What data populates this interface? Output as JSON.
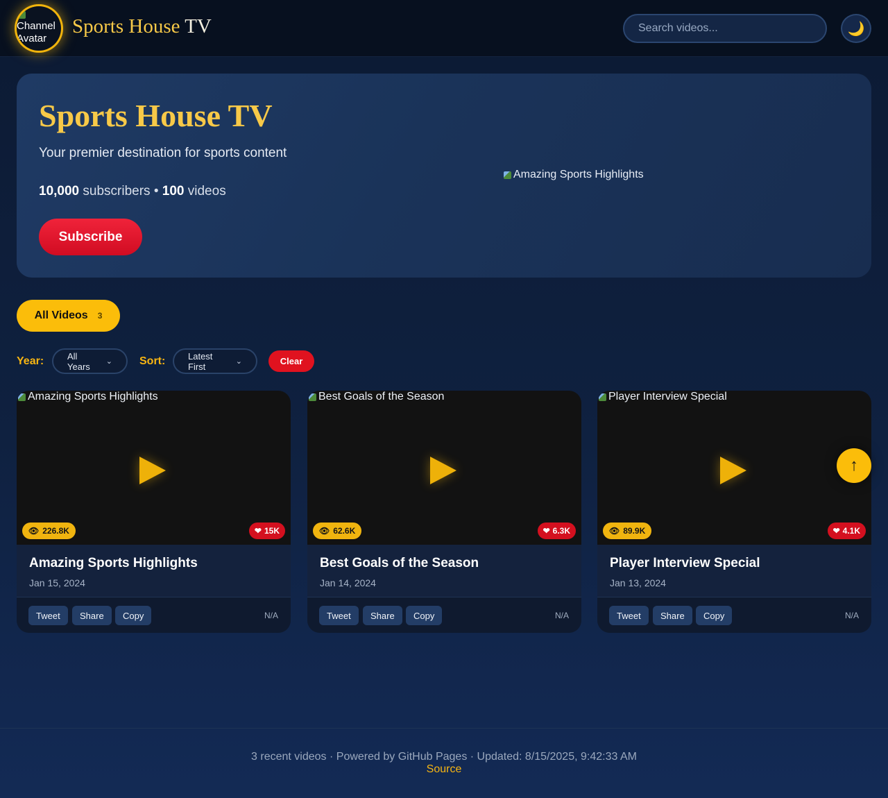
{
  "header": {
    "avatar_alt": "Channel Avatar",
    "brand_main": "Sports House",
    "brand_tv": "TV",
    "search_placeholder": "Search videos...",
    "theme_icon": "moon-icon"
  },
  "hero": {
    "title": "Sports House TV",
    "subtitle": "Your premier destination for sports content",
    "subscribers": "10,000",
    "subscribers_label": "subscribers",
    "separator": "•",
    "videos": "100",
    "videos_label": "videos",
    "subscribe_label": "Subscribe",
    "featured_alt": "Amazing Sports Highlights"
  },
  "filters": {
    "tab_label": "All Videos",
    "tab_count": "3",
    "year_label": "Year:",
    "year_value": "All Years",
    "sort_label": "Sort:",
    "sort_value": "Latest First",
    "clear_label": "Clear"
  },
  "videos": [
    {
      "title": "Amazing Sports Highlights",
      "date": "Jan 15, 2024",
      "views": "226.8K",
      "likes": "15K"
    },
    {
      "title": "Best Goals of the Season",
      "date": "Jan 14, 2024",
      "views": "62.6K",
      "likes": "6.3K"
    },
    {
      "title": "Player Interview Special",
      "date": "Jan 13, 2024",
      "views": "89.9K",
      "likes": "4.1K"
    }
  ],
  "card_actions": {
    "tweet": "Tweet",
    "share": "Share",
    "copy": "Copy",
    "duration": "N/A"
  },
  "scroll_top_label": "↑",
  "footer": {
    "summary": "3 recent videos · Powered by GitHub Pages · Updated: 8/15/2025, 9:42:33 AM",
    "source_link": "Source"
  },
  "colors": {
    "accent": "#f7c948",
    "brand_red": "#e0121f",
    "background": "#0f2140"
  }
}
